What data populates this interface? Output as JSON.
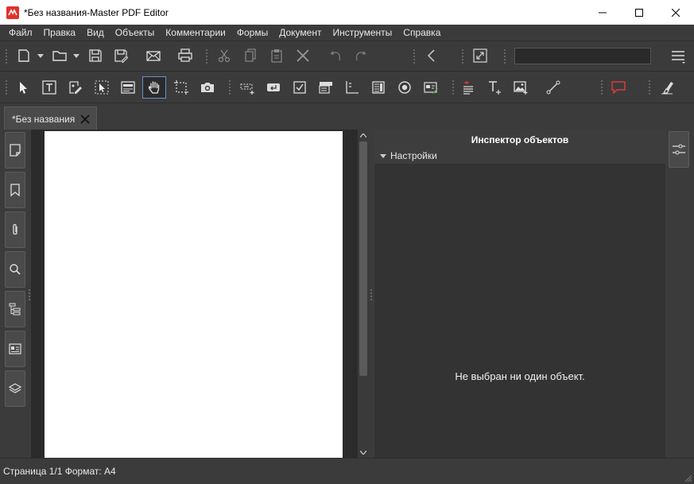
{
  "window": {
    "title": "*Без названия-Master PDF Editor",
    "brand_color": "#e0322b"
  },
  "menu": {
    "items": [
      "Файл",
      "Правка",
      "Вид",
      "Объекты",
      "Комментарии",
      "Формы",
      "Документ",
      "Инструменты",
      "Справка"
    ]
  },
  "toolbar_main": {
    "icons": [
      "new-document-icon",
      "open-folder-icon",
      "save-icon",
      "save-as-icon",
      "email-icon",
      "print-icon",
      "cut-icon",
      "copy-icon",
      "paste-icon",
      "delete-icon",
      "undo-icon",
      "redo-icon",
      "back-icon",
      "fit-page-icon",
      "hamburger-menu-icon"
    ],
    "search": {
      "value": "",
      "placeholder": ""
    }
  },
  "toolbar_tools": {
    "icons": [
      "select-arrow-icon",
      "edit-text-icon",
      "edit-forms-icon",
      "select-object-icon",
      "edit-object-icon",
      "hand-icon",
      "crop-icon",
      "snapshot-icon",
      "text-field-icon",
      "button-icon",
      "checkbox-icon",
      "combobox-icon",
      "listbox-icon",
      "list-icon",
      "radio-button-icon",
      "signature-icon",
      "sticky-note-icon",
      "add-text-icon",
      "add-image-icon",
      "line-icon",
      "comment-icon",
      "eraser-icon"
    ],
    "active": "hand-icon",
    "accent_red": "#e03a3a"
  },
  "tabs": [
    {
      "label": "*Без названия"
    }
  ],
  "sidebar": {
    "icons": [
      "pages-icon",
      "bookmarks-icon",
      "attachments-icon",
      "search-icon",
      "structure-icon",
      "form-fields-icon",
      "layers-icon"
    ]
  },
  "inspector": {
    "title": "Инспектор объектов",
    "section": "Настройки",
    "empty_message": "Не выбран ни один объект."
  },
  "status": {
    "text": "Страница 1/1 Формат: A4"
  }
}
